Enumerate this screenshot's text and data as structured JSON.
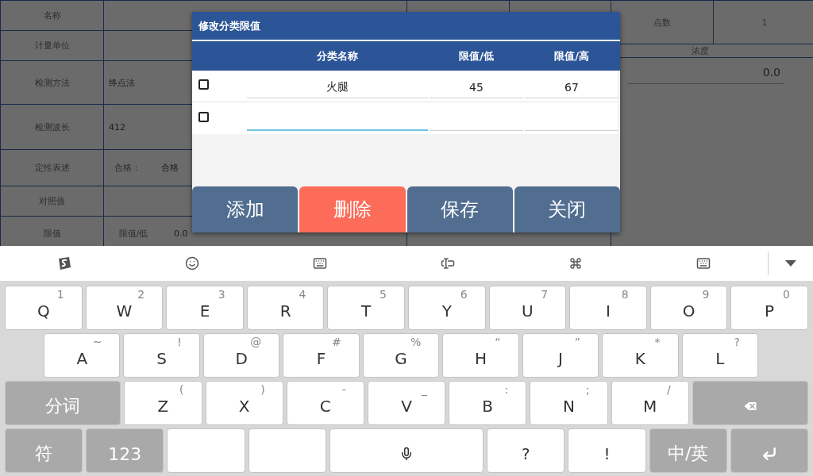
{
  "form": {
    "rows": [
      {
        "label": "名称"
      },
      {
        "label": "计量单位"
      },
      {
        "label": "检测方法",
        "value": "终点法"
      },
      {
        "label": "检测波长",
        "value": "412"
      },
      {
        "label": "定性表述",
        "prefix": "合格：",
        "value": "合格"
      },
      {
        "label": "对照值"
      },
      {
        "label": "限值",
        "prefix": "限值/低",
        "value": "0.0"
      }
    ],
    "side": {
      "points_label": "点数",
      "points_value": "1",
      "concentration_label": "浓度",
      "concentration_value": "0.0"
    }
  },
  "dialog": {
    "title": "修改分类限值",
    "columns": [
      "分类名称",
      "限值/低",
      "限值/高"
    ],
    "rows": [
      {
        "checked": false,
        "name": "火腿",
        "low": "45",
        "high": "67",
        "focused": false
      },
      {
        "checked": false,
        "focused": true
      }
    ],
    "buttons": [
      {
        "label": "添加",
        "kind": "normal"
      },
      {
        "label": "删除",
        "kind": "danger"
      },
      {
        "label": "保存",
        "kind": "normal"
      },
      {
        "label": "关闭",
        "kind": "normal"
      }
    ]
  },
  "keyboard": {
    "rows": [
      [
        {
          "kind": "letter",
          "main": "Q",
          "sub": "1"
        },
        {
          "kind": "letter",
          "main": "W",
          "sub": "2"
        },
        {
          "kind": "letter",
          "main": "E",
          "sub": "3"
        },
        {
          "kind": "letter",
          "main": "R",
          "sub": "4"
        },
        {
          "kind": "letter",
          "main": "T",
          "sub": "5"
        },
        {
          "kind": "letter",
          "main": "Y",
          "sub": "6"
        },
        {
          "kind": "letter",
          "main": "U",
          "sub": "7"
        },
        {
          "kind": "letter",
          "main": "I",
          "sub": "8"
        },
        {
          "kind": "letter",
          "main": "O",
          "sub": "9"
        },
        {
          "kind": "letter",
          "main": "P",
          "sub": "0"
        }
      ],
      [
        {
          "kind": "letter",
          "main": "A",
          "sub": "~"
        },
        {
          "kind": "letter",
          "main": "S",
          "sub": "!"
        },
        {
          "kind": "letter",
          "main": "D",
          "sub": "@"
        },
        {
          "kind": "letter",
          "main": "F",
          "sub": "#"
        },
        {
          "kind": "letter",
          "main": "G",
          "sub": "%"
        },
        {
          "kind": "letter",
          "main": "H",
          "sub": "“"
        },
        {
          "kind": "letter",
          "main": "J",
          "sub": "”"
        },
        {
          "kind": "letter",
          "main": "K",
          "sub": "*"
        },
        {
          "kind": "letter",
          "main": "L",
          "sub": "?"
        }
      ],
      [
        {
          "kind": "function",
          "main": "分词"
        },
        {
          "kind": "letter",
          "main": "Z",
          "sub": "("
        },
        {
          "kind": "letter",
          "main": "X",
          "sub": ")"
        },
        {
          "kind": "letter",
          "main": "C",
          "sub": "-"
        },
        {
          "kind": "letter",
          "main": "V",
          "sub": "_"
        },
        {
          "kind": "letter",
          "main": "B",
          "sub": ":"
        },
        {
          "kind": "letter",
          "main": "N",
          "sub": ";"
        },
        {
          "kind": "letter",
          "main": "M",
          "sub": "/"
        },
        {
          "kind": "backspace"
        }
      ],
      [
        {
          "kind": "function",
          "main": "符"
        },
        {
          "kind": "function",
          "main": "123"
        },
        {
          "kind": "blank"
        },
        {
          "kind": "blank"
        },
        {
          "kind": "space"
        },
        {
          "kind": "letter",
          "main": "?"
        },
        {
          "kind": "letter",
          "main": "!"
        },
        {
          "kind": "function",
          "main": "中/英"
        },
        {
          "kind": "enter"
        }
      ]
    ]
  }
}
